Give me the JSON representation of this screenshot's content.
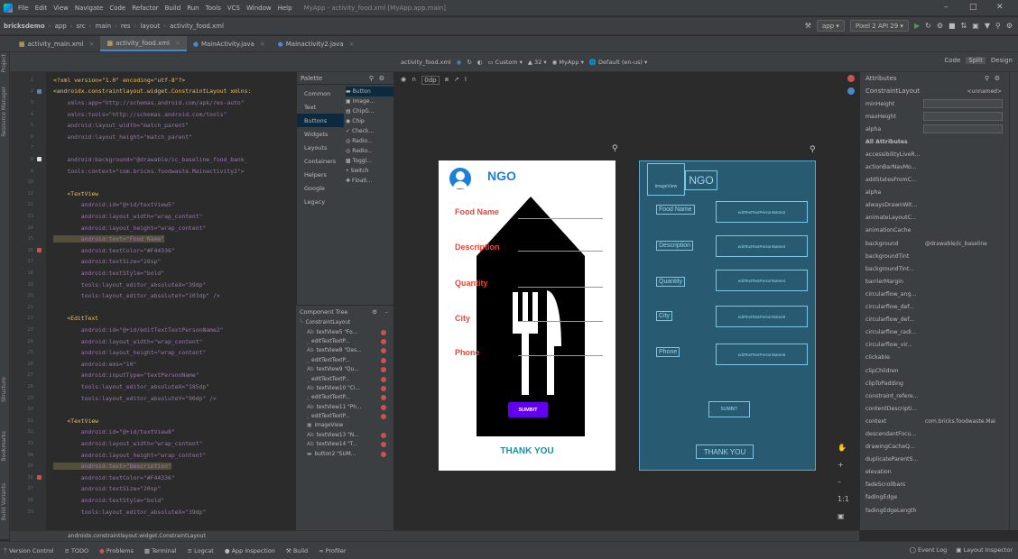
{
  "menubar": {
    "items": [
      "File",
      "Edit",
      "View",
      "Navigate",
      "Code",
      "Refactor",
      "Build",
      "Run",
      "Tools",
      "VCS",
      "Window",
      "Help"
    ],
    "window_title": "MyApp - activity_food.xml [MyApp.app.main]"
  },
  "navbar": {
    "breadcrumbs": [
      "bricksdemo",
      "app",
      "src",
      "main",
      "res",
      "layout",
      "activity_food.xml"
    ],
    "run_config": "app",
    "device": "Pixel 2 API 29"
  },
  "tabs": [
    {
      "label": "activity_main.xml",
      "active": false
    },
    {
      "label": "activity_food.xml",
      "active": true
    },
    {
      "label": "MainActivity.java",
      "active": false
    },
    {
      "label": "Mainactivity2.java",
      "active": false
    }
  ],
  "view_modes": {
    "code": "Code",
    "split": "Split",
    "design": "Design"
  },
  "left_tools": {
    "project": "Project",
    "resource_manager": "Resource Manager",
    "structure": "Structure",
    "bookmarks": "Bookmarks",
    "build_variants": "Build Variants"
  },
  "code_lines": [
    {
      "n": "1",
      "text": "<?xml version=\"1.0\" encoding=\"utf-8\"?>",
      "kind": "tag"
    },
    {
      "n": "2",
      "text": "<androidx.constraintlayout.widget.ConstraintLayout xmlns:",
      "kind": "tag"
    },
    {
      "n": "3",
      "text": "    xmlns:app=\"http://schemas.android.com/apk/res-auto\"",
      "kind": "attr"
    },
    {
      "n": "4",
      "text": "    xmlns:tools=\"http://schemas.android.com/tools\"",
      "kind": "attr"
    },
    {
      "n": "5",
      "text": "    android:layout_width=\"match_parent\"",
      "kind": "attr"
    },
    {
      "n": "6",
      "text": "    android:layout_height=\"match_parent\"",
      "kind": "attr"
    },
    {
      "n": "7",
      "text": "",
      "kind": "plain"
    },
    {
      "n": "8",
      "text": "    android:background=\"@drawable/ic_baseline_food_bank_",
      "kind": "attr"
    },
    {
      "n": "9",
      "text": "    tools:context=\"com.bricks.foodwaste.Mainactivity2\">",
      "kind": "attr"
    },
    {
      "n": "10",
      "text": "",
      "kind": "plain"
    },
    {
      "n": "11",
      "text": "    <TextView",
      "kind": "tag"
    },
    {
      "n": "12",
      "text": "        android:id=\"@+id/textView5\"",
      "kind": "attr"
    },
    {
      "n": "13",
      "text": "        android:layout_width=\"wrap_content\"",
      "kind": "attr"
    },
    {
      "n": "14",
      "text": "        android:layout_height=\"wrap_content\"",
      "kind": "attr"
    },
    {
      "n": "15",
      "text": "        android:text=\"Food Name\"",
      "kind": "hl"
    },
    {
      "n": "16",
      "text": "        android:textColor=\"#F44336\"",
      "kind": "attr"
    },
    {
      "n": "17",
      "text": "        android:textSize=\"20sp\"",
      "kind": "attr"
    },
    {
      "n": "18",
      "text": "        android:textStyle=\"bold\"",
      "kind": "attr"
    },
    {
      "n": "19",
      "text": "        tools:layout_editor_absoluteX=\"39dp\"",
      "kind": "attr"
    },
    {
      "n": "20",
      "text": "        tools:layout_editor_absoluteY=\"103dp\" />",
      "kind": "attr"
    },
    {
      "n": "21",
      "text": "",
      "kind": "plain"
    },
    {
      "n": "22",
      "text": "    <EditText",
      "kind": "tag"
    },
    {
      "n": "23",
      "text": "        android:id=\"@+id/editTextTextPersonName2\"",
      "kind": "attr"
    },
    {
      "n": "24",
      "text": "        android:layout_width=\"wrap_content\"",
      "kind": "attr"
    },
    {
      "n": "25",
      "text": "        android:layout_height=\"wrap_content\"",
      "kind": "attr"
    },
    {
      "n": "26",
      "text": "        android:ems=\"10\"",
      "kind": "attr"
    },
    {
      "n": "27",
      "text": "        android:inputType=\"textPersonName\"",
      "kind": "attr"
    },
    {
      "n": "28",
      "text": "        tools:layout_editor_absoluteX=\"185dp\"",
      "kind": "attr"
    },
    {
      "n": "29",
      "text": "        tools:layout_editor_absoluteY=\"90dp\" />",
      "kind": "attr"
    },
    {
      "n": "30",
      "text": "",
      "kind": "plain"
    },
    {
      "n": "31",
      "text": "    <TextView",
      "kind": "tag"
    },
    {
      "n": "32",
      "text": "        android:id=\"@+id/textView8\"",
      "kind": "attr"
    },
    {
      "n": "33",
      "text": "        android:layout_width=\"wrap_content\"",
      "kind": "attr"
    },
    {
      "n": "34",
      "text": "        android:layout_height=\"wrap_content\"",
      "kind": "attr"
    },
    {
      "n": "35",
      "text": "        android:text=\"Description\"",
      "kind": "hl"
    },
    {
      "n": "36",
      "text": "        android:textColor=\"#F44336\"",
      "kind": "attr"
    },
    {
      "n": "37",
      "text": "        android:textSize=\"20sp\"",
      "kind": "attr"
    },
    {
      "n": "38",
      "text": "        android:textStyle=\"bold\"",
      "kind": "attr"
    },
    {
      "n": "39",
      "text": "        tools:layout_editor_absoluteX=\"39dp\"",
      "kind": "attr"
    }
  ],
  "editor_crumb": "androidx.constraintlayout.widget.ConstraintLayout",
  "palette": {
    "title": "Palette",
    "categories": [
      "Common",
      "Text",
      "Buttons",
      "Widgets",
      "Layouts",
      "Containers",
      "Helpers",
      "Google",
      "Legacy"
    ],
    "selected_category": "Buttons",
    "items": [
      "Button",
      "Image...",
      "ChipG...",
      "Chip",
      "Check...",
      "Radio...",
      "Radio...",
      "Toggl...",
      "Switch",
      "Floati..."
    ]
  },
  "component_tree": {
    "title": "Component Tree",
    "rows": [
      "ConstraintLayout",
      "textView5 \"Fo...",
      "editTextTextP...",
      "textView8 \"Des...",
      "editTextTextP...",
      "textView9 \"Qu...",
      "editTextTextP...",
      "textView10 \"Ci...",
      "editTextTextP...",
      "textView11 \"Ph...",
      "editTextTextP...",
      "imageView",
      "textView13 \"N...",
      "textView14 \"T...",
      "button2 \"SUM..."
    ]
  },
  "canvas_toolbar": {
    "file": "activity_food.xml",
    "zoom": "0dp",
    "device": "Custom",
    "api": "32",
    "theme": "MyApp",
    "locale": "Default (en-us)"
  },
  "phone": {
    "title": "NGO",
    "labels": [
      "Food Name",
      "Description",
      "Quantity",
      "City",
      "Phone"
    ],
    "button": "SUMBIT",
    "footer": "THANK YOU"
  },
  "blueprint": {
    "image_label": "imageView",
    "title": "NGO",
    "labels": [
      "Food Name",
      "Description",
      "Quantity",
      "City",
      "Phone"
    ],
    "inputs": [
      "editTextTextPersonName2",
      "editTextTextPersonName3",
      "editTextTextPersonName4",
      "editTextTextPersonName5",
      "editTextTextPersonName6"
    ],
    "button": "SUMBIT",
    "footer": "THANK YOU"
  },
  "attributes": {
    "title": "Attributes",
    "component": "ConstraintLayout",
    "unnamed": "<unnamed>",
    "rows": [
      {
        "name": "minHeight",
        "value": "",
        "box": true
      },
      {
        "name": "maxHeight",
        "value": "",
        "box": true
      },
      {
        "name": "alpha",
        "value": "",
        "box": true
      },
      {
        "name": "All Attributes",
        "value": "",
        "section": true
      },
      {
        "name": "accessibilityLiveR...",
        "value": "",
        "box": false
      },
      {
        "name": "actionBarNavMo...",
        "value": "",
        "box": false
      },
      {
        "name": "addStatesFromC...",
        "value": "",
        "box": false
      },
      {
        "name": "alpha",
        "value": "",
        "box": false
      },
      {
        "name": "alwaysDrawnWit...",
        "value": "",
        "box": false
      },
      {
        "name": "animateLayoutC...",
        "value": "",
        "box": false
      },
      {
        "name": "animationCache",
        "value": "",
        "box": false
      },
      {
        "name": "background",
        "value": "@drawable/ic_baseline",
        "box": false
      },
      {
        "name": "backgroundTint",
        "value": "",
        "box": false
      },
      {
        "name": "backgroundTint...",
        "value": "",
        "box": false
      },
      {
        "name": "barrierMargin",
        "value": "",
        "box": false
      },
      {
        "name": "circularflow_ang...",
        "value": "",
        "box": false
      },
      {
        "name": "circularflow_def...",
        "value": "",
        "box": false
      },
      {
        "name": "circularflow_def...",
        "value": "",
        "box": false
      },
      {
        "name": "circularflow_radi...",
        "value": "",
        "box": false
      },
      {
        "name": "circularflow_vir...",
        "value": "",
        "box": false
      },
      {
        "name": "clickable",
        "value": "",
        "box": false
      },
      {
        "name": "clipChildren",
        "value": "",
        "box": false
      },
      {
        "name": "clipToPadding",
        "value": "",
        "box": false
      },
      {
        "name": "constraint_refere...",
        "value": "",
        "box": false
      },
      {
        "name": "contentDescripti...",
        "value": "",
        "box": false
      },
      {
        "name": "context",
        "value": "com.bricks.foodwaste.Mai",
        "box": false
      },
      {
        "name": "descendantFocu...",
        "value": "",
        "box": false
      },
      {
        "name": "drawingCacheQ...",
        "value": "",
        "box": false
      },
      {
        "name": "duplicateParentS...",
        "value": "",
        "box": false
      },
      {
        "name": "elevation",
        "value": "",
        "box": false
      },
      {
        "name": "fadeScrollbars",
        "value": "",
        "box": false
      },
      {
        "name": "fadingEdge",
        "value": "",
        "box": false
      },
      {
        "name": "fadingEdgeLength",
        "value": "",
        "box": false
      }
    ]
  },
  "statusbar": {
    "items": [
      "Version Control",
      "TODO",
      "Problems",
      "Terminal",
      "Logcat",
      "App Inspection",
      "Build",
      "Profiler"
    ],
    "right": [
      "Event Log",
      "Layout Inspector"
    ]
  },
  "colors": {
    "label_red": "#f44336",
    "ngo_blue": "#1c7fd8",
    "submit_purple": "#6200ee",
    "thankyou_teal": "#1b8fa3",
    "blueprint_bg": "#285a72"
  }
}
